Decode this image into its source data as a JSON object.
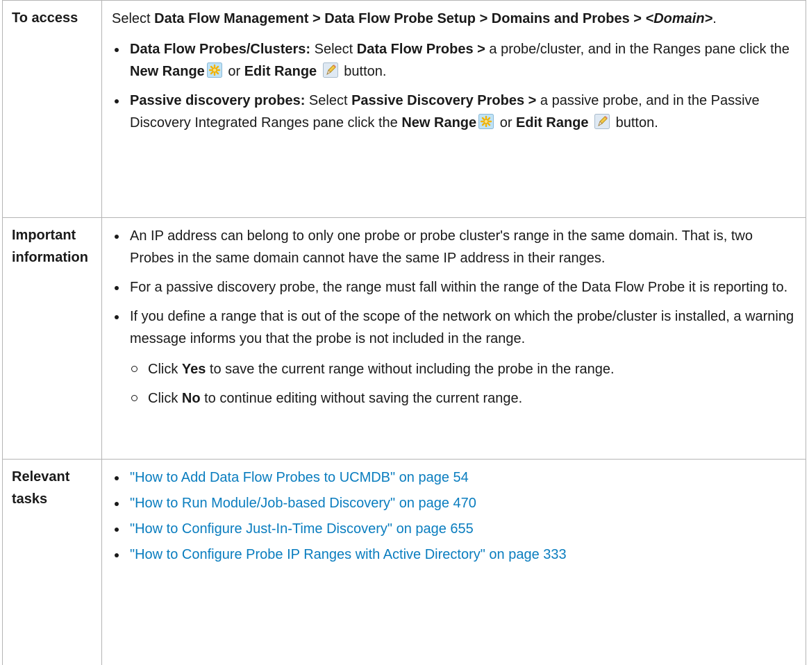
{
  "access": {
    "label": "To access",
    "intro": {
      "select": "Select ",
      "path": "Data Flow Management > Data Flow Probe Setup > Domains and Probes > ",
      "domain": "<Domain>",
      "end": "."
    },
    "items": [
      {
        "title": "Data Flow Probes/Clusters:",
        "t1": " Select ",
        "b1": "Data Flow Probes >",
        "t2": " a probe/cluster, and in the Ranges pane click the ",
        "new_range": "New Range",
        "new_icon": "new-range-icon",
        "or": " or ",
        "edit_range": "Edit Range",
        "edit_icon": "edit-range-icon",
        "button": " button."
      },
      {
        "title": "Passive discovery probes:",
        "t1": " Select ",
        "b1": "Passive Discovery Probes >",
        "t2": " a passive probe, and in the Passive Discovery Integrated Ranges pane click the ",
        "new_range": "New Range",
        "new_icon": "new-range-icon",
        "or": " or ",
        "edit_range": "Edit Range",
        "edit_icon": "edit-range-icon",
        "button": " button."
      }
    ]
  },
  "important": {
    "label": "Important information",
    "items": [
      "An IP address can belong to only one probe or probe cluster's range in the same domain. That is, two Probes in the same domain cannot have the same IP address in their ranges.",
      "For a passive discovery probe, the range must fall within the range of the Data Flow Probe it is reporting to.",
      "If you define a range that is out of the scope of the network on which the probe/cluster is installed, a warning message informs you that the probe is not included in the range."
    ],
    "subitems": [
      {
        "pre": "Click ",
        "bold": "Yes",
        "post": " to save the current range without including the probe in the range."
      },
      {
        "pre": "Click ",
        "bold": "No",
        "post": " to continue editing without saving the current range."
      }
    ]
  },
  "tasks": {
    "label": "Relevant tasks",
    "links": [
      "\"How to Add Data Flow Probes to UCMDB\" on page 54",
      "\"How to Run Module/Job-based Discovery\" on page 470",
      "\"How to Configure Just-In-Time Discovery\" on page 655",
      "\"How to Configure Probe IP Ranges with Active Directory\" on page 333"
    ]
  },
  "colors": {
    "link": "#0a7dbf",
    "border": "#b5b5b5",
    "text": "#1a1a1a"
  }
}
